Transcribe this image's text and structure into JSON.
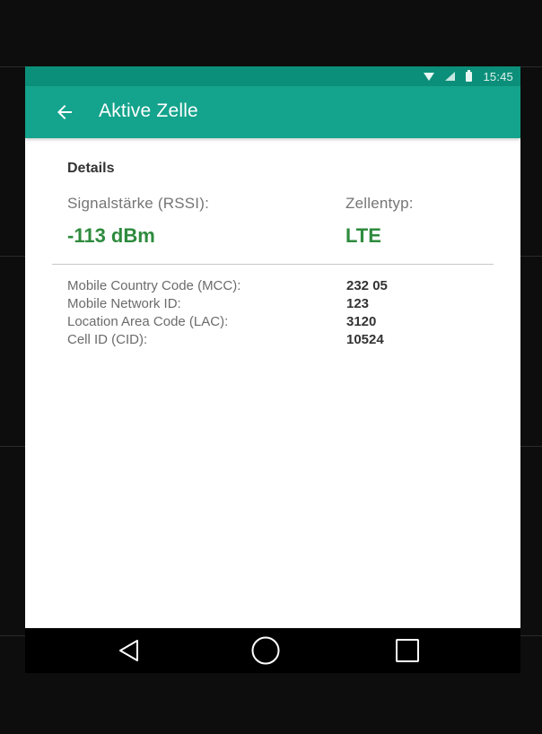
{
  "status_bar": {
    "time": "15:45",
    "icons": [
      "wifi-icon",
      "signal-icon",
      "battery-icon"
    ]
  },
  "app_bar": {
    "title": "Aktive Zelle",
    "back_icon": "arrow-left-icon"
  },
  "details": {
    "section_title": "Details",
    "signal_label": "Signalstärke (RSSI):",
    "signal_value": "-113 dBm",
    "cell_type_label": "Zellentyp:",
    "cell_type_value": "LTE",
    "info_rows": [
      {
        "key": "Mobile Country Code (MCC):",
        "value": "232 05"
      },
      {
        "key": "Mobile Network ID:",
        "value": "123"
      },
      {
        "key": "Location Area Code (LAC):",
        "value": "3120"
      },
      {
        "key": "Cell ID (CID):",
        "value": "10524"
      }
    ]
  },
  "nav_bar": {
    "buttons": [
      "back-triangle-icon",
      "home-circle-icon",
      "recents-square-icon"
    ]
  },
  "colors": {
    "status_bar": "#0c8f7a",
    "app_bar": "#14a38c",
    "value_green": "#2e8b3e",
    "nav_bar": "#000000"
  }
}
